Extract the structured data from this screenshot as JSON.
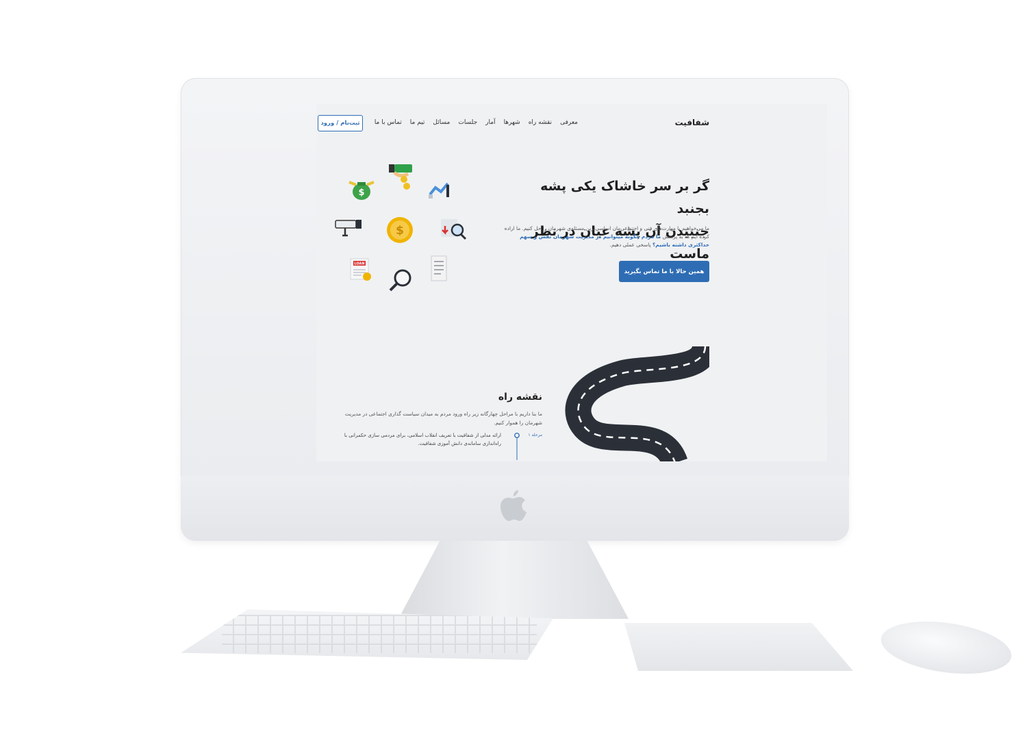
{
  "site": {
    "brand": "شفافیت",
    "nav": [
      "معرفی",
      "نقشه راه",
      "شهرها",
      "آمار",
      "جلسات",
      "مسائل",
      "تیم ما",
      "تماس با ما"
    ],
    "auth_button": "ثبت‌نام / ورود"
  },
  "hero": {
    "title_line1": "گر بر سر خاشاک یکی پشه بجنبد",
    "title_line2": "جنبیدن آن پشه عیان در نظر ماست",
    "desc_part1": "ما می‌خواهیم با مهارت‌های فنی و اجتماعی‌مان اساسی‌ترین مسئله‌ی شهرمان را حل کنیم. ما اراده کرده ایم که به پرسش",
    "desc_highlight": "ما مردم چگونه میتوانیم در مدیریت شهرمان نقش و سهم حداکثری داشته باشیم؟",
    "desc_part2": "پاسخی عملی دهیم.",
    "cta_label": "همین حالا با ما تماس بگیرید"
  },
  "roadmap": {
    "title": "نقشه راه",
    "desc": "ما بنا داریم با مراحل چهارگانه زیر راه ورود مردم به میدان سیاست گذاری اجتماعی در مدیریت شهرمان را هموار کنیم.",
    "step1_label": "مرحله ۱",
    "step1_text": "ارائه مدلی از شفافیت با تعریف انقلاب اسلامی، برای مردمی سازی حکمرانی با راه‌اندازی سامانه‌ی دانش آموزی شفافیت."
  },
  "icons": [
    "money-bag-icon",
    "cash-hand-icon",
    "chart-icon",
    "cctv-camera-icon",
    "coin-icon",
    "document-search-icon",
    "loan-document-icon",
    "magnifier-icon",
    "receipt-icon",
    "apple-logo"
  ],
  "colors": {
    "accent": "#2e6db4",
    "screen_bg": "#f0f1f3",
    "road": "#2b3038"
  }
}
